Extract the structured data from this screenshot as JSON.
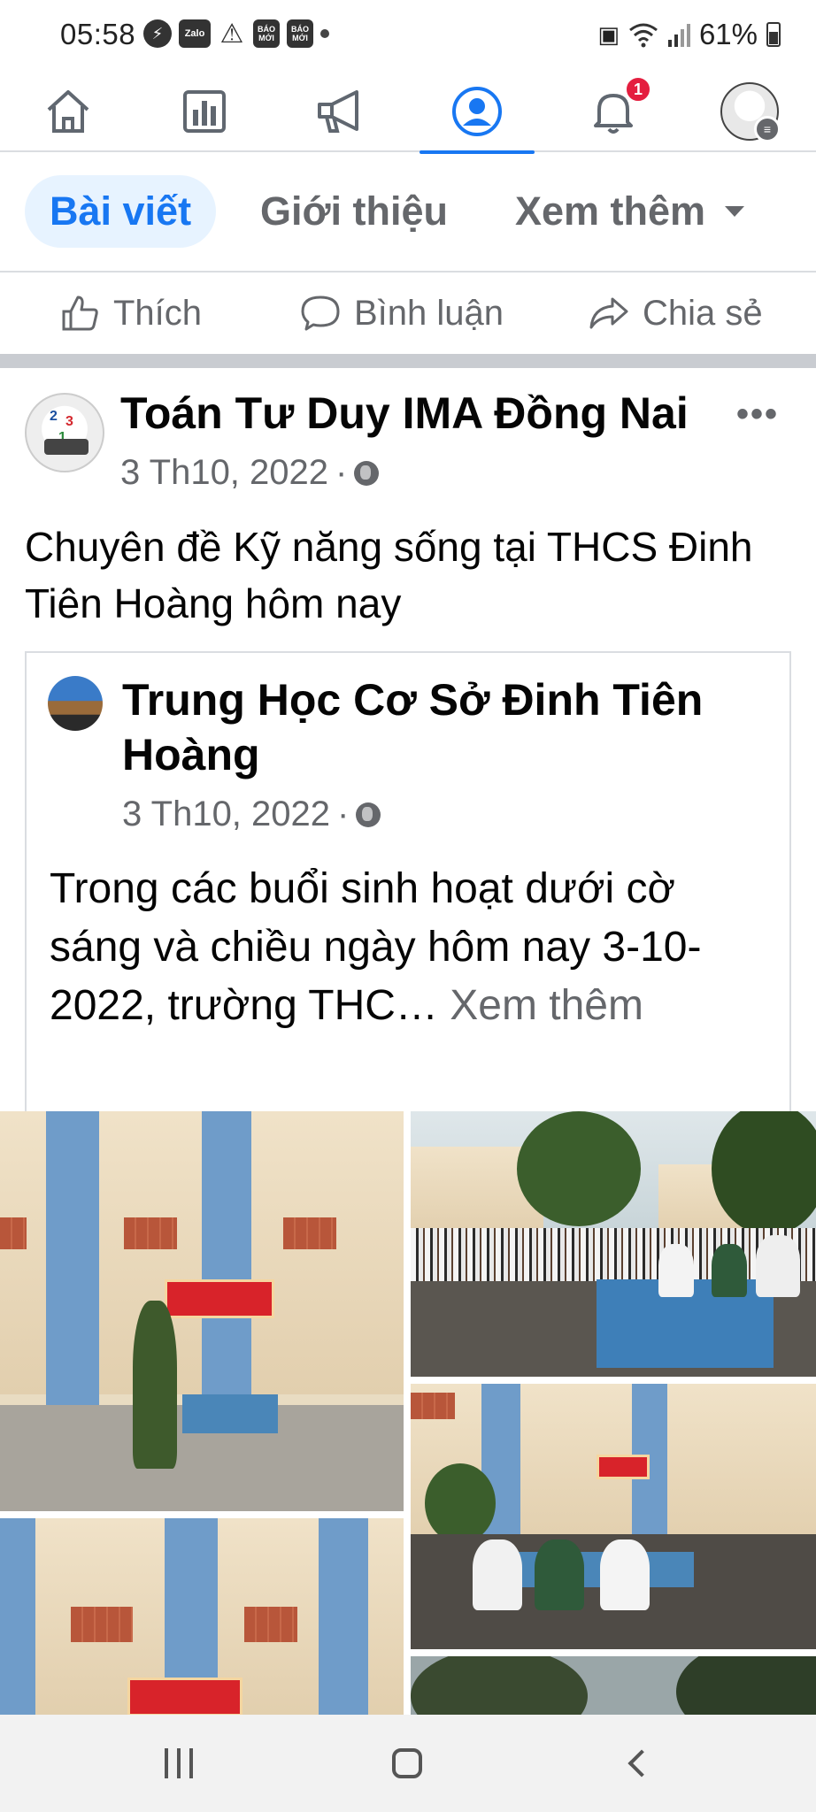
{
  "status_bar": {
    "time": "05:58",
    "icons": [
      "messenger-icon",
      "zalo-icon",
      "warning-icon",
      "baomoi-icon",
      "baomoi-icon",
      "dot-icon"
    ],
    "zalo_label": "Zalo",
    "baomoi_label": "BÁO MỚI",
    "battery_percent": "61%",
    "right_icons": [
      "battery-saver-icon",
      "wifi-icon",
      "signal-icon",
      "battery-icon"
    ]
  },
  "top_nav": {
    "items": [
      "home-icon",
      "pages-icon",
      "megaphone-icon",
      "profile-icon",
      "bell-icon",
      "avatar-menu"
    ],
    "active_index": 3,
    "notification_count": "1",
    "accent_color": "#1877f2"
  },
  "tabs": [
    {
      "label": "Bài viết",
      "active": true
    },
    {
      "label": "Giới thiệu",
      "active": false
    },
    {
      "label": "Xem thêm",
      "active": false
    }
  ],
  "actions": {
    "like": "Thích",
    "comment": "Bình luận",
    "share": "Chia sẻ"
  },
  "post": {
    "author": "Toán Tư Duy IMA Đồng Nai",
    "date": "3 Th10, 2022",
    "separator": "·",
    "more": "•••",
    "text": "Chuyên đề Kỹ năng sống tại THCS Đinh Tiên Hoàng hôm nay",
    "shared": {
      "author": "Trung Học Cơ Sở Đinh Tiên Hoàng",
      "date": "3 Th10, 2022",
      "separator": "·",
      "text": "Trong các buổi sinh hoạt dưới cờ sáng và chiều ngày hôm nay 3-10-2022, trường THC…",
      "see_more": "Xem thêm"
    }
  }
}
